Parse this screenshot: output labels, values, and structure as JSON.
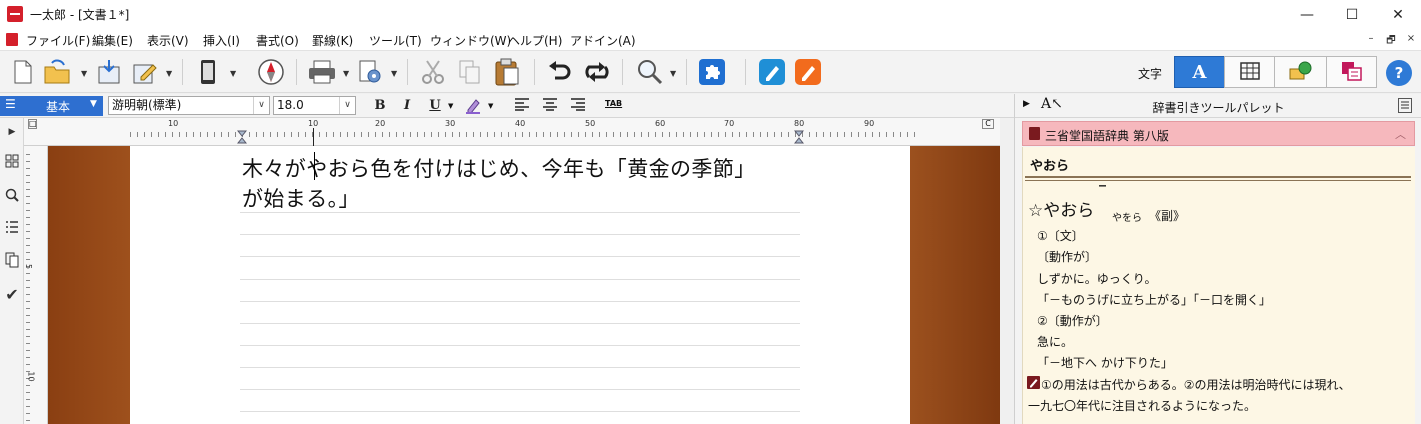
{
  "window": {
    "title": "一太郎 - [文書１*]",
    "controls": {
      "minimize": "—",
      "maximize": "☐",
      "close": "✕"
    }
  },
  "menu": {
    "items": [
      "ファイル(F)",
      "編集(E)",
      "表示(V)",
      "挿入(I)",
      "書式(O)",
      "罫線(K)",
      "ツール(T)",
      "ウィンドウ(W)",
      "ヘルプ(H)",
      "アドイン(A)"
    ],
    "mdi": {
      "minimize": "–",
      "restore": "🗗",
      "close": "×"
    }
  },
  "toolbar": {
    "moji_label": "文字",
    "mode_text_glyph": "A",
    "help_glyph": "?"
  },
  "format": {
    "style": "基本",
    "font": "游明朝(標準)",
    "size": "18.0",
    "bold": "B",
    "italic": "I",
    "underline": "U",
    "tab_label": "TAB"
  },
  "ruler": {
    "labels": [
      "10",
      "10",
      "20",
      "30",
      "40",
      "50",
      "60",
      "70",
      "80",
      "90"
    ],
    "vertical_labels": [
      "5",
      "10"
    ],
    "corner_left": "□",
    "corner_right": "C"
  },
  "document": {
    "line1": "木々がやおら色を付けはじめ、今年も「黄金の季節」",
    "line2": "が始まる。」"
  },
  "palette": {
    "title": "辞書引きツールパレット",
    "dictionary": "三省堂国語辞典 第八版",
    "headword": "やおら",
    "entry": {
      "word": "☆やおら",
      "accent_mark": "‾",
      "reading": "やをら",
      "pos": "《副》",
      "lines": [
        "①〔文〕",
        "〔動作が〕",
        "しずかに。ゆっくり。",
        "「－ものうげに立ち上がる」「－口を開く」",
        "②〔動作が〕",
        "急に。",
        "「－地下へ かけ下りた」"
      ],
      "note_line1": "①の用法は古代からある。②の用法は明治時代には現れ、",
      "note_line2": "一九七〇年代に注目されるようになった。"
    }
  },
  "colors": {
    "accent_blue": "#2e7ad6",
    "dict_bar": "#f6b8bd",
    "dict_bg": "#fdf7e5",
    "wood": "#a25420"
  }
}
